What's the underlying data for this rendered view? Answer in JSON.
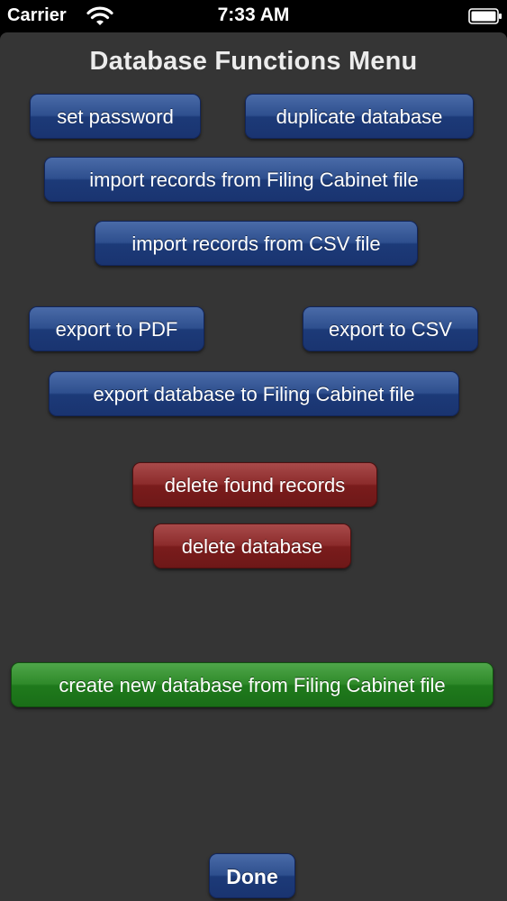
{
  "status_bar": {
    "carrier": "Carrier",
    "time": "7:33 AM",
    "icons": [
      "wifi-icon",
      "battery-icon"
    ]
  },
  "title": "Database Functions Menu",
  "buttons": {
    "set_password": "set password",
    "duplicate_database": "duplicate database",
    "import_filing_cabinet": "import records from Filing Cabinet file",
    "import_csv": "import records from CSV file",
    "export_pdf": "export to PDF",
    "export_csv": "export to CSV",
    "export_filing_cabinet": "export database to Filing Cabinet file",
    "delete_found_records": "delete found records",
    "delete_database": "delete database",
    "create_new_database": "create new database from Filing Cabinet file",
    "done": "Done"
  },
  "colors": {
    "background": "#353535",
    "blue_button": "#2e4f8e",
    "red_button": "#8c2c2c",
    "green_button": "#2f8a2a"
  }
}
